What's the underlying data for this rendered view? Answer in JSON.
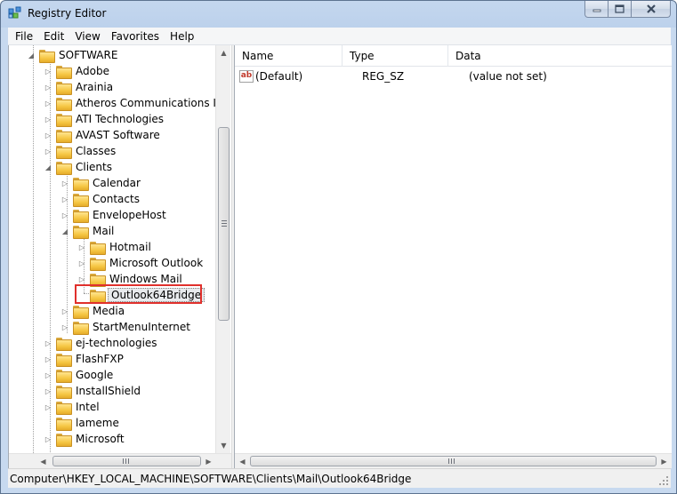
{
  "window": {
    "title": "Registry Editor",
    "app_icon": "registry-editor-icon"
  },
  "menu": [
    {
      "label": "File"
    },
    {
      "label": "Edit"
    },
    {
      "label": "View"
    },
    {
      "label": "Favorites"
    },
    {
      "label": "Help"
    }
  ],
  "tree": {
    "nodes": [
      {
        "label": "SOFTWARE",
        "expanded": true
      },
      {
        "label": "Adobe"
      },
      {
        "label": "Arainia"
      },
      {
        "label": "Atheros Communications Inc"
      },
      {
        "label": "ATI Technologies"
      },
      {
        "label": "AVAST Software"
      },
      {
        "label": "Classes"
      },
      {
        "label": "Clients",
        "expanded": true
      },
      {
        "label": "Calendar"
      },
      {
        "label": "Contacts"
      },
      {
        "label": "EnvelopeHost"
      },
      {
        "label": "Mail",
        "expanded": true
      },
      {
        "label": "Hotmail"
      },
      {
        "label": "Microsoft Outlook"
      },
      {
        "label": "Windows Mail"
      },
      {
        "label": "Outlook64Bridge",
        "selected": true
      },
      {
        "label": "Media"
      },
      {
        "label": "StartMenuInternet"
      },
      {
        "label": "ej-technologies"
      },
      {
        "label": "FlashFXP"
      },
      {
        "label": "Google"
      },
      {
        "label": "InstallShield"
      },
      {
        "label": "Intel"
      },
      {
        "label": "lameme"
      },
      {
        "label": "Microsoft"
      }
    ]
  },
  "list": {
    "columns": {
      "name": "Name",
      "type": "Type",
      "data": "Data"
    },
    "rows": [
      {
        "icon": "string-value-icon",
        "icon_text": "ab",
        "name": "(Default)",
        "type": "REG_SZ",
        "data": "(value not set)"
      }
    ]
  },
  "status": {
    "path": "Computer\\HKEY_LOCAL_MACHINE\\SOFTWARE\\Clients\\Mail\\Outlook64Bridge"
  }
}
